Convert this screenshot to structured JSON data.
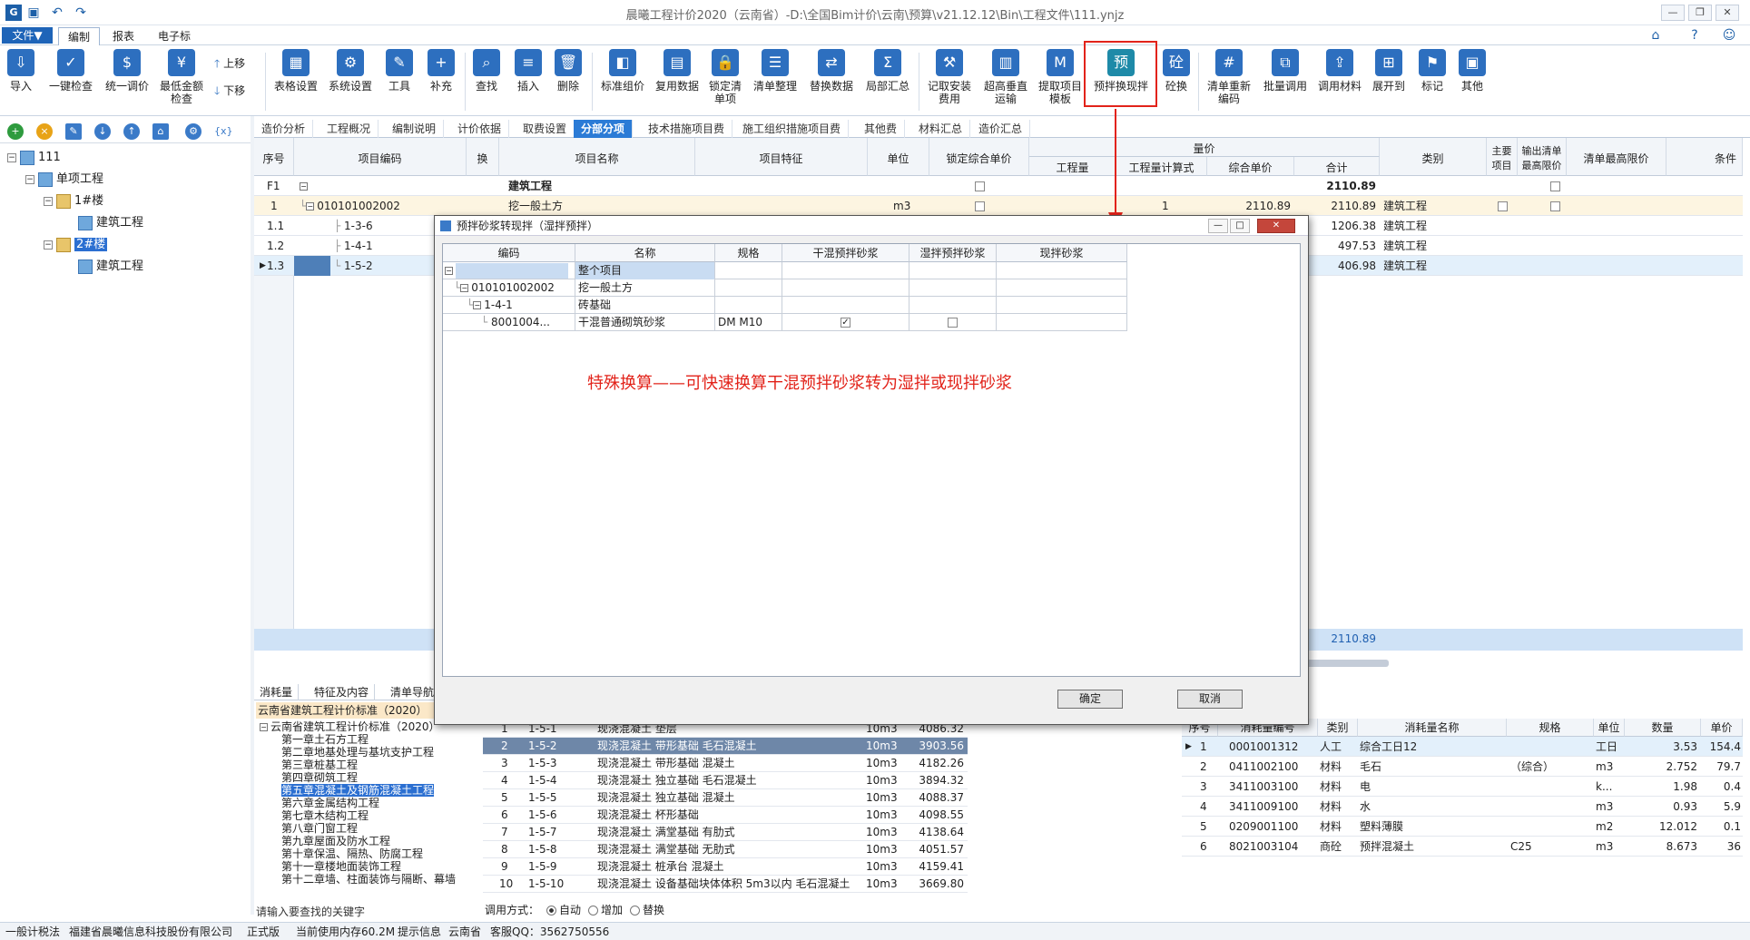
{
  "app": {
    "title": "晨曦工程计价2020（云南省）-D:\\全国Bim计价\\云南\\预算\\v21.12.12\\Bin\\工程文件\\111.ynjz"
  },
  "menu": {
    "file": "文件▼",
    "tabs": [
      "编制",
      "报表",
      "电子标"
    ]
  },
  "ribbon": {
    "buttons": [
      {
        "label": "导入",
        "icon": "import-icon"
      },
      {
        "label": "一键检查",
        "icon": "check-icon"
      },
      {
        "label": "统一调价",
        "icon": "price-adjust-icon"
      },
      {
        "label": "最低金额\n检查",
        "icon": "min-amount-icon"
      },
      {
        "label": "表格设置",
        "icon": "table-settings-icon"
      },
      {
        "label": "系统设置",
        "icon": "system-settings-icon"
      },
      {
        "label": "工具",
        "icon": "tools-icon"
      },
      {
        "label": "补充",
        "icon": "supplement-icon"
      },
      {
        "label": "查找",
        "icon": "find-icon"
      },
      {
        "label": "插入",
        "icon": "insert-icon"
      },
      {
        "label": "删除",
        "icon": "delete-icon"
      },
      {
        "label": "标准组价",
        "icon": "standard-pricing-icon"
      },
      {
        "label": "复用数据",
        "icon": "reuse-data-icon"
      },
      {
        "label": "锁定清\n单项",
        "icon": "lock-list-icon"
      },
      {
        "label": "清单整理",
        "icon": "list-organize-icon"
      },
      {
        "label": "替换数据",
        "icon": "replace-data-icon"
      },
      {
        "label": "局部汇总",
        "icon": "partial-summary-icon"
      },
      {
        "label": "记取安装\n费用",
        "icon": "install-fee-icon"
      },
      {
        "label": "超高垂直\n运输",
        "icon": "vertical-transport-icon"
      },
      {
        "label": "提取项目\n模板",
        "icon": "extract-template-icon"
      },
      {
        "label": "预拌换现拌",
        "icon": "premix-convert-icon"
      },
      {
        "label": "砼换",
        "icon": "concrete-swap-icon"
      },
      {
        "label": "清单重新\n编码",
        "icon": "recode-icon"
      },
      {
        "label": "批量调用",
        "icon": "batch-call-icon"
      },
      {
        "label": "调用材料",
        "icon": "call-material-icon"
      },
      {
        "label": "展开到",
        "icon": "expand-to-icon"
      },
      {
        "label": "标记",
        "icon": "mark-icon"
      },
      {
        "label": "其他",
        "icon": "other-icon"
      }
    ],
    "up": "上移",
    "down": "下移"
  },
  "tree": {
    "root": "111",
    "single": "单项工程",
    "b1": "1#楼",
    "b1_child": "建筑工程",
    "b2": "2#楼",
    "b2_child": "建筑工程"
  },
  "tabs": [
    "造价分析",
    "工程概况",
    "编制说明",
    "计价依据",
    "取费设置",
    "分部分项",
    "技术措施项目费",
    "施工组织措施项目费",
    "其他费",
    "材料汇总",
    "造价汇总"
  ],
  "grid": {
    "headers": {
      "seq": "序号",
      "code": "项目编码",
      "swap": "换",
      "name": "项目名称",
      "feature": "项目特征",
      "unit": "单位",
      "lock": "锁定综合单价",
      "qty_group": "量价",
      "qty": "工程量",
      "qty_formula": "工程量计算式",
      "unit_price": "综合单价",
      "total": "合计",
      "category": "类别",
      "main": "主要\n项目",
      "output": "输出清单\n最高限价",
      "max_price": "清单最高限价",
      "cond": "条件"
    },
    "rows": [
      {
        "seq": "F1",
        "code": "",
        "name": "建筑工程",
        "unit": "",
        "qty": "",
        "price": "",
        "total": "2110.89",
        "cat": ""
      },
      {
        "seq": "1",
        "code": "010101002002",
        "name": "挖一般土方",
        "unit": "m3",
        "qty": "1",
        "price": "2110.89",
        "total": "2110.89",
        "cat": "建筑工程"
      },
      {
        "seq": "1.1",
        "code": "1-3-6",
        "name": "",
        "unit": "",
        "qty": "",
        "price": "",
        "total": "1206.38",
        "cat": "建筑工程"
      },
      {
        "seq": "1.2",
        "code": "1-4-1",
        "name": "",
        "unit": "",
        "qty": "",
        "price": "",
        "total": "497.53",
        "cat": "建筑工程"
      },
      {
        "seq": "1.3",
        "code": "1-5-2",
        "name": "",
        "unit": "",
        "qty": "",
        "price": "",
        "total": "406.98",
        "cat": "建筑工程"
      }
    ],
    "sum": "2110.89"
  },
  "bottom": {
    "tabs": [
      "消耗量",
      "特征及内容",
      "清单导航"
    ],
    "std_title": "云南省建筑工程计价标准（2020）",
    "std_root": "云南省建筑工程计价标准（2020）",
    "chapters": [
      "第一章土石方工程",
      "第二章地基处理与基坑支护工程",
      "第三章桩基工程",
      "第四章砌筑工程",
      "第五章混凝土及钢筋混凝土工程",
      "第六章金属结构工程",
      "第七章木结构工程",
      "第八章门窗工程",
      "第九章屋面及防水工程",
      "第十章保温、隔热、防腐工程",
      "第十一章楼地面装饰工程",
      "第十二章墙、柱面装饰与隔断、幕墙"
    ],
    "search_hint": "请输入要查找的关键字",
    "quota_rows": [
      {
        "n": "1",
        "code": "1-5-1",
        "name": "现浇混凝土 垫层",
        "unit": "10m3",
        "price": "4086.32"
      },
      {
        "n": "2",
        "code": "1-5-2",
        "name": "现浇混凝土 带形基础 毛石混凝土",
        "unit": "10m3",
        "price": "3903.56"
      },
      {
        "n": "3",
        "code": "1-5-3",
        "name": "现浇混凝土 带形基础 混凝土",
        "unit": "10m3",
        "price": "4182.26"
      },
      {
        "n": "4",
        "code": "1-5-4",
        "name": "现浇混凝土 独立基础 毛石混凝土",
        "unit": "10m3",
        "price": "3894.32"
      },
      {
        "n": "5",
        "code": "1-5-5",
        "name": "现浇混凝土 独立基础 混凝土",
        "unit": "10m3",
        "price": "4088.37"
      },
      {
        "n": "6",
        "code": "1-5-6",
        "name": "现浇混凝土 杯形基础",
        "unit": "10m3",
        "price": "4098.55"
      },
      {
        "n": "7",
        "code": "1-5-7",
        "name": "现浇混凝土 满堂基础 有肋式",
        "unit": "10m3",
        "price": "4138.64"
      },
      {
        "n": "8",
        "code": "1-5-8",
        "name": "现浇混凝土 满堂基础 无肋式",
        "unit": "10m3",
        "price": "4051.57"
      },
      {
        "n": "9",
        "code": "1-5-9",
        "name": "现浇混凝土 桩承台 混凝土",
        "unit": "10m3",
        "price": "4159.41"
      },
      {
        "n": "10",
        "code": "1-5-10",
        "name": "现浇混凝土 设备基础块体体积 5m3以内 毛石混凝土",
        "unit": "10m3",
        "price": "3669.80"
      }
    ],
    "call_mode": {
      "label": "调用方式：",
      "auto": "自动",
      "add": "增加",
      "replace": "替换"
    },
    "res_headers": {
      "seq": "序号",
      "code": "消耗量编号",
      "type": "类别",
      "name": "消耗量名称",
      "spec": "规格",
      "unit": "单位",
      "qty": "数量",
      "price": "单价"
    },
    "res_rows": [
      {
        "seq": "1",
        "code": "0001001312",
        "type": "人工",
        "name": "综合工日12",
        "spec": "",
        "unit": "工日",
        "qty": "3.53",
        "price": "154.4"
      },
      {
        "seq": "2",
        "code": "0411002100",
        "type": "材料",
        "name": "毛石",
        "spec": "（综合）",
        "unit": "m3",
        "qty": "2.752",
        "price": "79.7"
      },
      {
        "seq": "3",
        "code": "3411003100",
        "type": "材料",
        "name": "电",
        "spec": "",
        "unit": "k...",
        "qty": "1.98",
        "price": "0.4"
      },
      {
        "seq": "4",
        "code": "3411009100",
        "type": "材料",
        "name": "水",
        "spec": "",
        "unit": "m3",
        "qty": "0.93",
        "price": "5.9"
      },
      {
        "seq": "5",
        "code": "0209001100",
        "type": "材料",
        "name": "塑料薄膜",
        "spec": "",
        "unit": "m2",
        "qty": "12.012",
        "price": "0.1"
      },
      {
        "seq": "6",
        "code": "8021003104",
        "type": "商砼",
        "name": "预拌混凝土",
        "spec": "C25",
        "unit": "m3",
        "qty": "8.673",
        "price": "36"
      }
    ]
  },
  "status": {
    "tax": "一般计税法",
    "company": "福建省晨曦信息科技股份有限公司",
    "edition": "正式版",
    "memory": "当前使用内存60.2M",
    "hint": "提示信息",
    "region": "云南省",
    "qq": "客服QQ：3562750556"
  },
  "dialog": {
    "title": "预拌砂浆转现拌（湿拌预拌）",
    "headers": {
      "code": "编码",
      "name": "名称",
      "spec": "规格",
      "dry": "干混预拌砂浆",
      "wet": "湿拌预拌砂浆",
      "site": "现拌砂浆"
    },
    "rows": [
      {
        "code": "",
        "name": "整个项目",
        "spec": ""
      },
      {
        "code": "010101002002",
        "name": "挖一般土方",
        "spec": ""
      },
      {
        "code": "1-4-1",
        "name": "砖基础",
        "spec": ""
      },
      {
        "code": "8001004...",
        "name": "干混普通砌筑砂浆",
        "spec": "DM M10"
      }
    ],
    "note": "特殊换算——可快速换算干混预拌砂浆转为湿拌或现拌砂浆",
    "ok": "确定",
    "cancel": "取消"
  },
  "colors": {
    "accent": "#2b7bd6",
    "highlight": "#e2231a",
    "selection": "#2b6fd1"
  }
}
